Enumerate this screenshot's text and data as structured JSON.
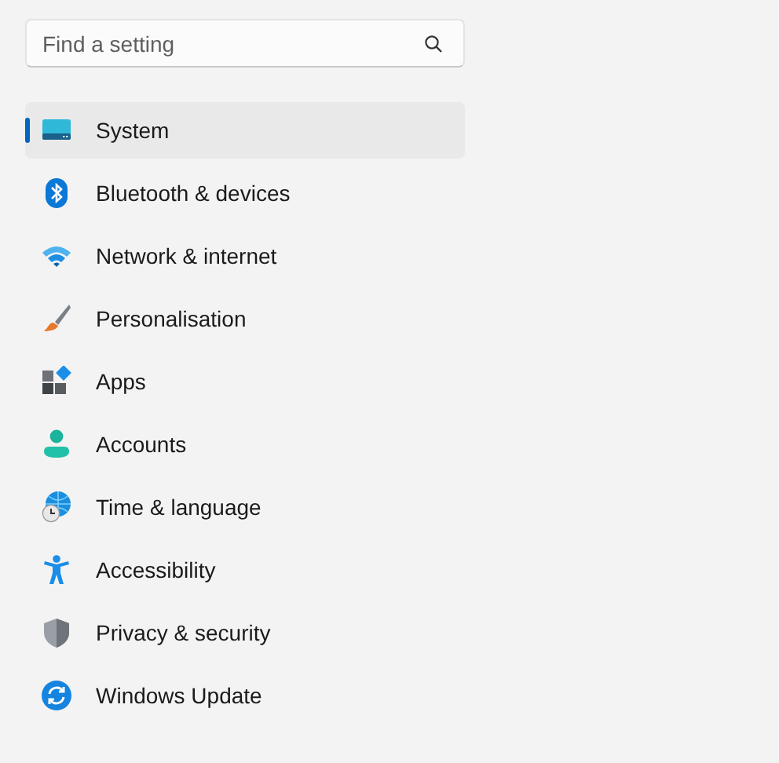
{
  "search": {
    "placeholder": "Find a setting"
  },
  "nav": [
    {
      "label": "System",
      "selected": true
    },
    {
      "label": "Bluetooth & devices",
      "selected": false
    },
    {
      "label": "Network & internet",
      "selected": false
    },
    {
      "label": "Personalisation",
      "selected": false
    },
    {
      "label": "Apps",
      "selected": false
    },
    {
      "label": "Accounts",
      "selected": false
    },
    {
      "label": "Time & language",
      "selected": false
    },
    {
      "label": "Accessibility",
      "selected": false
    },
    {
      "label": "Privacy & security",
      "selected": false
    },
    {
      "label": "Windows Update",
      "selected": false
    }
  ]
}
